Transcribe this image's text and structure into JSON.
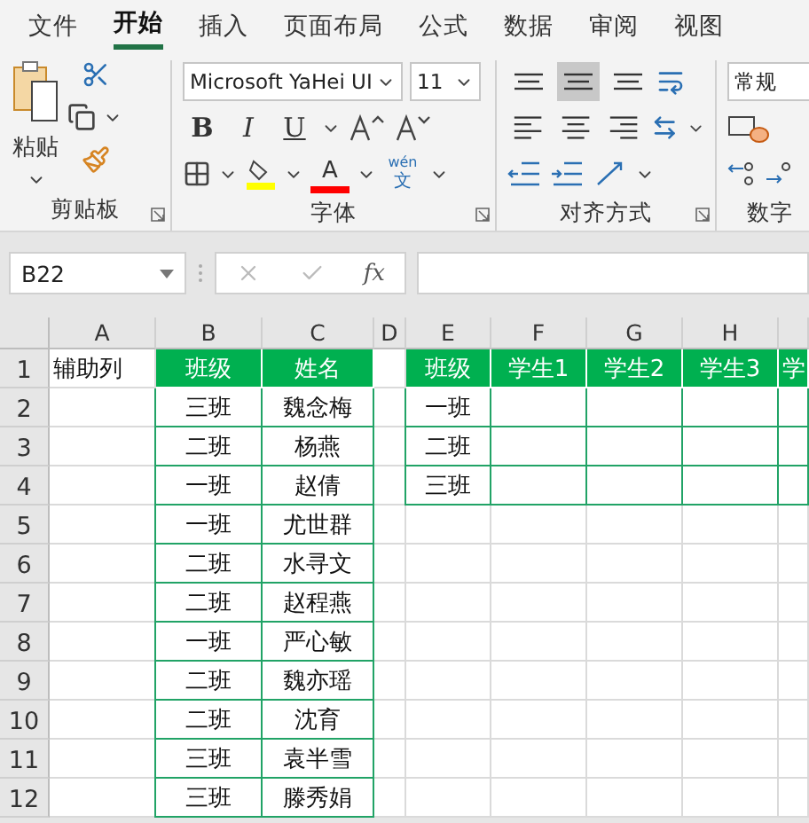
{
  "ribbon_tabs": [
    {
      "label": "文件",
      "selected": false
    },
    {
      "label": "开始",
      "selected": true
    },
    {
      "label": "插入",
      "selected": false
    },
    {
      "label": "页面布局",
      "selected": false
    },
    {
      "label": "公式",
      "selected": false
    },
    {
      "label": "数据",
      "selected": false
    },
    {
      "label": "审阅",
      "selected": false
    },
    {
      "label": "视图",
      "selected": false
    }
  ],
  "clipboard": {
    "paste_label": "粘贴",
    "group_label": "剪贴板"
  },
  "font": {
    "name": "Microsoft YaHei UI",
    "size": "11",
    "bold": "B",
    "italic": "I",
    "underline": "U",
    "font_color_letter": "A",
    "phonetic_top": "wén",
    "phonetic_bottom": "文",
    "group_label": "字体"
  },
  "alignment": {
    "buttons": [
      {
        "kind": "top",
        "selected": false
      },
      {
        "kind": "middle",
        "selected": true
      },
      {
        "kind": "bottom",
        "selected": false
      },
      {
        "kind": "left",
        "selected": false
      },
      {
        "kind": "center",
        "selected": false
      },
      {
        "kind": "right",
        "selected": false
      }
    ],
    "group_label": "对齐方式"
  },
  "number": {
    "format": "常规",
    "group_label": "数字"
  },
  "formula_bar": {
    "name_box": "B22",
    "fx": "fx"
  },
  "columns": [
    "A",
    "B",
    "C",
    "D",
    "E",
    "F",
    "G",
    "H"
  ],
  "rows": [
    {
      "number": "1",
      "cells": [
        {
          "text": "辅助列"
        },
        {
          "text": "班级",
          "kind": "header"
        },
        {
          "text": "姓名",
          "kind": "header"
        },
        {},
        {
          "text": "班级",
          "kind": "header"
        },
        {
          "text": "学生1",
          "kind": "header"
        },
        {
          "text": "学生2",
          "kind": "header"
        },
        {
          "text": "学生3",
          "kind": "header"
        },
        {
          "text": "学",
          "kind": "header"
        }
      ]
    },
    {
      "number": "2",
      "cells": [
        {},
        {
          "text": "三班",
          "kind": "bordered"
        },
        {
          "text": "魏念梅",
          "kind": "bordered"
        },
        {},
        {
          "text": "一班",
          "kind": "bordered"
        },
        {
          "kind": "bordered"
        },
        {
          "kind": "bordered"
        },
        {
          "kind": "bordered"
        },
        {
          "kind": "bordered"
        }
      ]
    },
    {
      "number": "3",
      "cells": [
        {},
        {
          "text": "二班",
          "kind": "bordered"
        },
        {
          "text": "杨燕",
          "kind": "bordered"
        },
        {},
        {
          "text": "二班",
          "kind": "bordered"
        },
        {
          "kind": "bordered"
        },
        {
          "kind": "bordered"
        },
        {
          "kind": "bordered"
        },
        {
          "kind": "bordered"
        }
      ]
    },
    {
      "number": "4",
      "cells": [
        {},
        {
          "text": "一班",
          "kind": "bordered"
        },
        {
          "text": "赵倩",
          "kind": "bordered"
        },
        {},
        {
          "text": "三班",
          "kind": "bordered"
        },
        {
          "kind": "bordered"
        },
        {
          "kind": "bordered"
        },
        {
          "kind": "bordered"
        },
        {
          "kind": "bordered"
        }
      ]
    },
    {
      "number": "5",
      "cells": [
        {},
        {
          "text": "一班",
          "kind": "bordered"
        },
        {
          "text": "尤世群",
          "kind": "bordered"
        },
        {},
        {},
        {},
        {},
        {},
        {}
      ]
    },
    {
      "number": "6",
      "cells": [
        {},
        {
          "text": "二班",
          "kind": "bordered"
        },
        {
          "text": "水寻文",
          "kind": "bordered"
        },
        {},
        {},
        {},
        {},
        {},
        {}
      ]
    },
    {
      "number": "7",
      "cells": [
        {},
        {
          "text": "二班",
          "kind": "bordered"
        },
        {
          "text": "赵程燕",
          "kind": "bordered"
        },
        {},
        {},
        {},
        {},
        {},
        {}
      ]
    },
    {
      "number": "8",
      "cells": [
        {},
        {
          "text": "一班",
          "kind": "bordered"
        },
        {
          "text": "严心敏",
          "kind": "bordered"
        },
        {},
        {},
        {},
        {},
        {},
        {}
      ]
    },
    {
      "number": "9",
      "cells": [
        {},
        {
          "text": "二班",
          "kind": "bordered"
        },
        {
          "text": "魏亦瑶",
          "kind": "bordered"
        },
        {},
        {},
        {},
        {},
        {},
        {}
      ]
    },
    {
      "number": "10",
      "cells": [
        {},
        {
          "text": "二班",
          "kind": "bordered"
        },
        {
          "text": "沈育",
          "kind": "bordered"
        },
        {},
        {},
        {},
        {},
        {},
        {}
      ]
    },
    {
      "number": "11",
      "cells": [
        {},
        {
          "text": "三班",
          "kind": "bordered"
        },
        {
          "text": "袁半雪",
          "kind": "bordered"
        },
        {},
        {},
        {},
        {},
        {},
        {}
      ]
    },
    {
      "number": "12",
      "cells": [
        {},
        {
          "text": "三班",
          "kind": "bordered"
        },
        {
          "text": "滕秀娟",
          "kind": "bordered"
        },
        {},
        {},
        {},
        {},
        {},
        {}
      ]
    }
  ]
}
